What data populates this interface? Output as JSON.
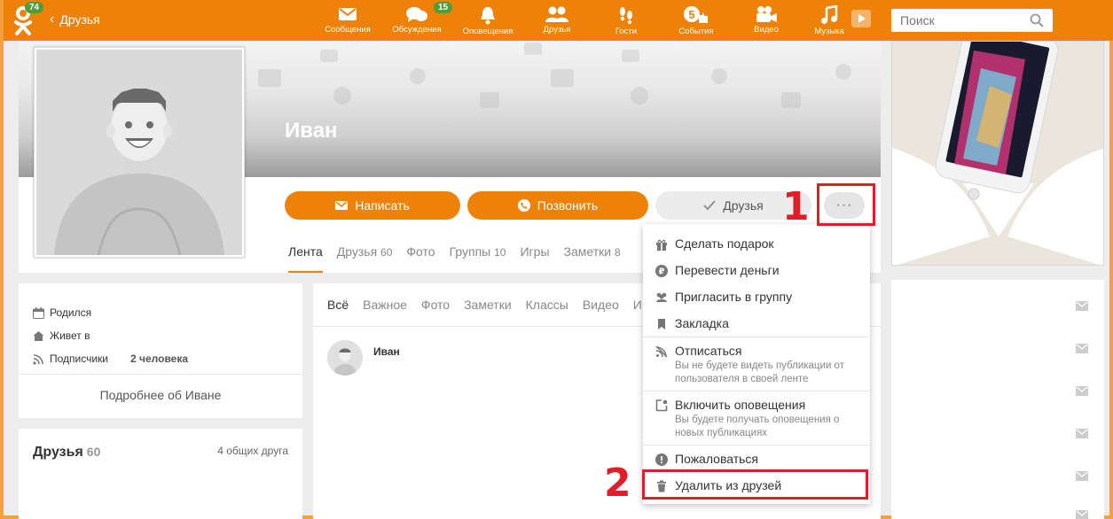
{
  "header": {
    "logo_badge": "74",
    "back_label": "Друзья",
    "nav": [
      {
        "label": "Сообщения",
        "icon": "envelope-icon"
      },
      {
        "label": "Обсуждения",
        "icon": "chat-bubbles-icon",
        "badge": "15"
      },
      {
        "label": "Оповещения",
        "icon": "bell-icon"
      },
      {
        "label": "Друзья",
        "icon": "people-icon"
      },
      {
        "label": "Гости",
        "icon": "footprints-icon"
      },
      {
        "label": "События",
        "icon": "events-icon",
        "badge": "5"
      },
      {
        "label": "Видео",
        "icon": "video-camera-icon"
      },
      {
        "label": "Музыка",
        "icon": "music-note-icon"
      }
    ],
    "search_placeholder": "Поиск"
  },
  "profile": {
    "name": "Иван",
    "buttons": {
      "write": "Написать",
      "call": "Позвонить",
      "friends": "Друзья",
      "more": "···"
    },
    "tabs": [
      {
        "label": "Лента",
        "count": ""
      },
      {
        "label": "Друзья",
        "count": "60"
      },
      {
        "label": "Фото",
        "count": ""
      },
      {
        "label": "Группы",
        "count": "10"
      },
      {
        "label": "Игры",
        "count": ""
      },
      {
        "label": "Заметки",
        "count": "8"
      }
    ]
  },
  "info": {
    "born_label": "Родился",
    "lives_label": "Живет в",
    "subscribers_label": "Подписчики",
    "subscribers_value": "2 человека",
    "more_link": "Подробнее об Иване"
  },
  "friends_block": {
    "title": "Друзья",
    "count": "60",
    "common": "4 общих друга"
  },
  "feed": {
    "tabs": [
      "Всё",
      "Важное",
      "Фото",
      "Заметки",
      "Классы",
      "Видео",
      "И"
    ],
    "post_author": "Иван"
  },
  "dropdown": {
    "items": [
      {
        "label": "Сделать подарок",
        "icon": "gift-icon"
      },
      {
        "label": "Перевести деньги",
        "icon": "ruble-coin-icon"
      },
      {
        "label": "Пригласить в группу",
        "icon": "group-invite-icon"
      },
      {
        "label": "Закладка",
        "icon": "bookmark-icon"
      },
      {
        "label": "Отписаться",
        "icon": "unsubscribe-icon",
        "sub": "Вы не будете видеть публикации от пользователя в своей ленте"
      },
      {
        "label": "Включить оповещения",
        "icon": "notify-icon",
        "sub": "Вы будете получать оповещения о новых публикациях"
      },
      {
        "label": "Пожаловаться",
        "icon": "warning-icon"
      },
      {
        "label": "Удалить из друзей",
        "icon": "trash-icon"
      }
    ]
  },
  "annotations": {
    "marker_1": "1",
    "marker_2": "2"
  },
  "colors": {
    "brand_orange": "#ee8208",
    "badge_green": "#4b9f38",
    "annotation_red": "#e11d2a"
  }
}
